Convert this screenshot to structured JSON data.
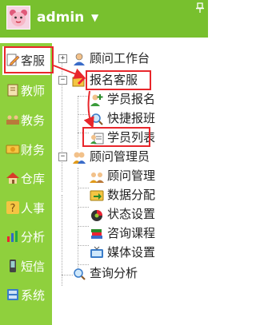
{
  "header": {
    "username": "admin",
    "dropdown_glyph": "▼"
  },
  "sidebar": {
    "items": [
      {
        "label": "客服",
        "icon": "pencil-edit-icon",
        "active": true
      },
      {
        "label": "教师",
        "icon": "book-icon"
      },
      {
        "label": "教务",
        "icon": "group-icon"
      },
      {
        "label": "财务",
        "icon": "money-icon"
      },
      {
        "label": "仓库",
        "icon": "house-icon"
      },
      {
        "label": "人事",
        "icon": "person-icon"
      },
      {
        "label": "分析",
        "icon": "bar-chart-icon"
      },
      {
        "label": "短信",
        "icon": "mobile-phone-icon"
      },
      {
        "label": "系统",
        "icon": "system-settings-icon"
      }
    ]
  },
  "tree": {
    "items": [
      {
        "label": "顾问工作台",
        "icon": "consultant-icon",
        "toggle": "+"
      },
      {
        "label": "报名客服",
        "icon": "edit-folder-icon",
        "toggle": "−"
      },
      {
        "label": "学员报名",
        "icon": "student-add-icon"
      },
      {
        "label": "快捷报班",
        "icon": "quick-search-icon"
      },
      {
        "label": "学员列表",
        "icon": "student-list-icon"
      },
      {
        "label": "顾问管理员",
        "icon": "admin-group-icon",
        "toggle": "−"
      },
      {
        "label": "顾问管理",
        "icon": "people-manage-icon"
      },
      {
        "label": "数据分配",
        "icon": "data-distribution-icon"
      },
      {
        "label": "状态设置",
        "icon": "status-setting-icon"
      },
      {
        "label": "咨询课程",
        "icon": "books-course-icon"
      },
      {
        "label": "媒体设置",
        "icon": "tv-media-icon"
      },
      {
        "label": "查询分析",
        "icon": "magnifier-icon"
      }
    ]
  },
  "colors": {
    "header": "#78c02e",
    "sidebar": "#8fd03d",
    "highlight": "#e8262b"
  }
}
